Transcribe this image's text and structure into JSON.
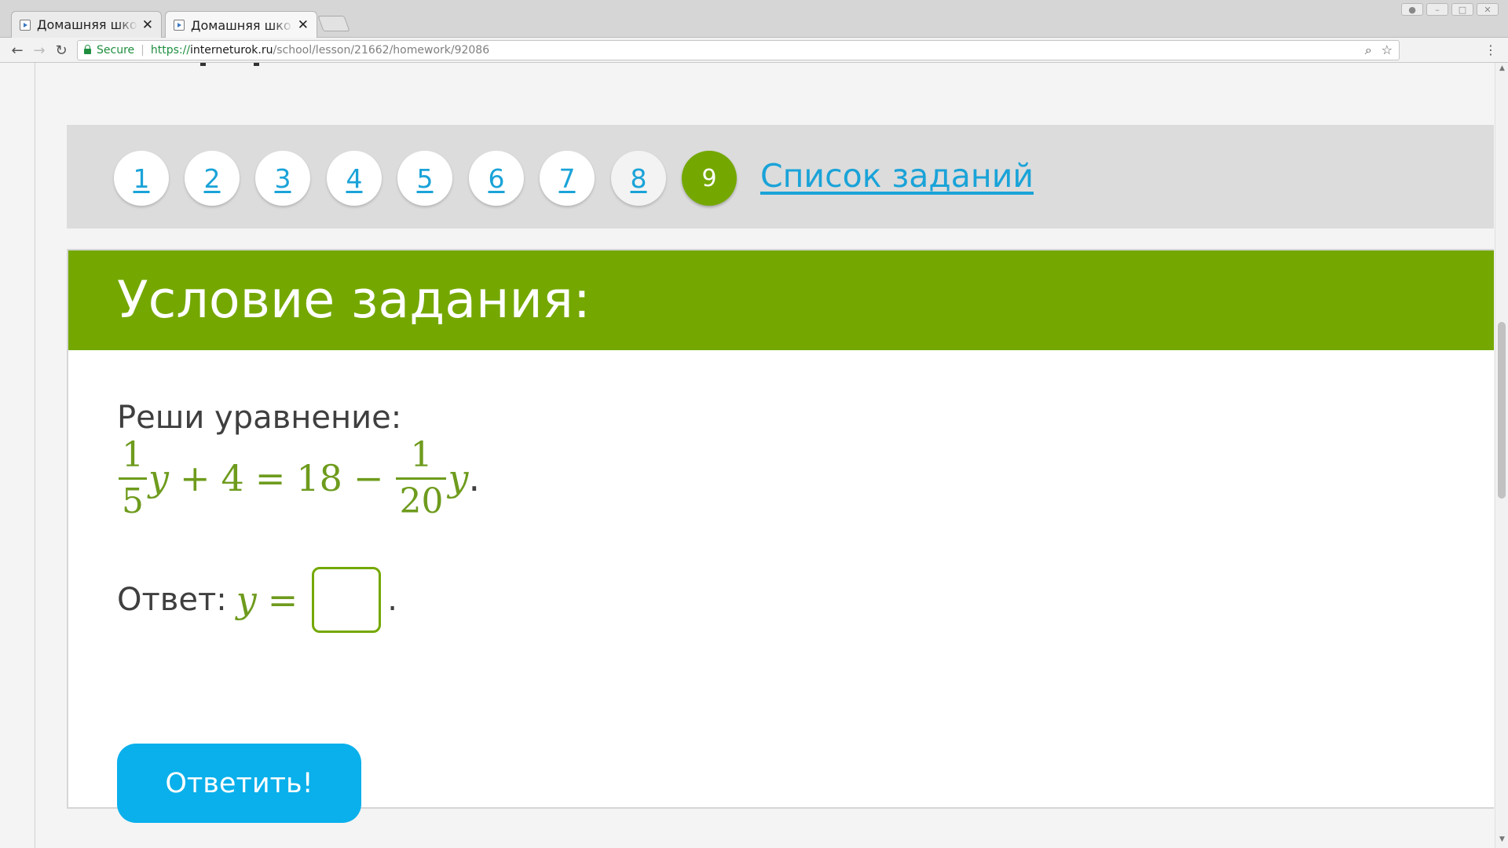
{
  "browser": {
    "tabs": [
      {
        "title": "Домашняя школа"
      },
      {
        "title": "Домашняя школа"
      }
    ],
    "tab_close": "✕",
    "secure_label": "Secure",
    "url": {
      "scheme": "https://",
      "host": "interneturok.ru",
      "path": "/school/lesson/21662/homework/92086"
    }
  },
  "question_nav": {
    "items": [
      {
        "label": "1",
        "state": "answered"
      },
      {
        "label": "2",
        "state": "answered"
      },
      {
        "label": "3",
        "state": "answered"
      },
      {
        "label": "4",
        "state": "answered"
      },
      {
        "label": "5",
        "state": "answered"
      },
      {
        "label": "6",
        "state": "answered"
      },
      {
        "label": "7",
        "state": "answered"
      },
      {
        "label": "8",
        "state": "visited"
      },
      {
        "label": "9",
        "state": "current"
      }
    ],
    "task_list_label": "Список заданий"
  },
  "task": {
    "header": "Условие задания:",
    "instruction": "Реши уравнение:",
    "equation": {
      "frac1_num": "1",
      "frac1_den": "5",
      "var1": "y",
      "plus": "+",
      "four": "4",
      "equals": "=",
      "eighteen": "18",
      "minus": "−",
      "frac2_num": "1",
      "frac2_den": "20",
      "var2": "y",
      "period": "."
    },
    "answer": {
      "label": "Ответ:",
      "var": "y",
      "equals": "=",
      "value": "",
      "period": "."
    },
    "submit_label": "Ответить!"
  },
  "colors": {
    "accent_green": "#74a800",
    "link_blue": "#1aa3d8",
    "button_blue": "#0ab0eb"
  }
}
